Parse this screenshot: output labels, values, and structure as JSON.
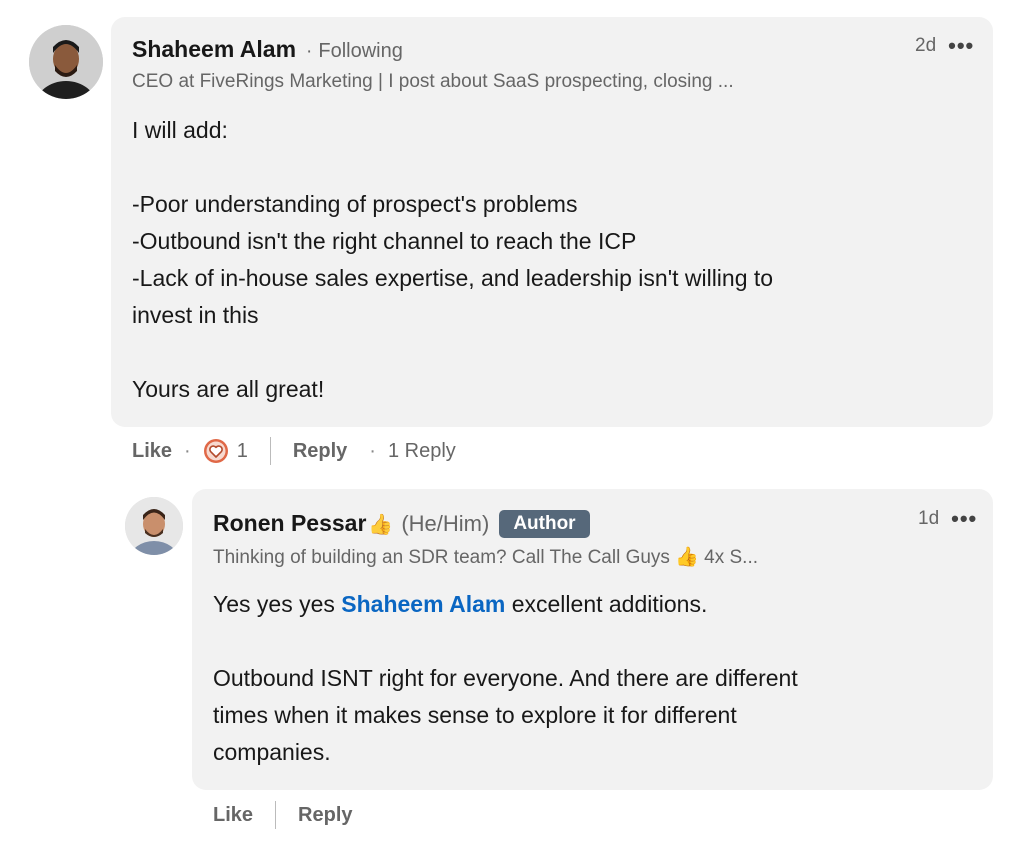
{
  "comment": {
    "author": "Shaheem Alam",
    "following": "Following",
    "headline": "CEO at FiveRings Marketing | I post about SaaS prospecting, closing ...",
    "time": "2d",
    "more_icon": "more-horizontal-icon",
    "body": {
      "line1": "I will add:",
      "line2": "-Poor understanding of prospect's problems",
      "line3": "-Outbound isn't the right channel to reach the ICP",
      "line4": "-Lack of in-house sales expertise, and leadership isn't willing to",
      "line5": "invest in this",
      "line6": "Yours are all great!"
    },
    "actions": {
      "like": "Like",
      "reaction_icon": "love-reaction-icon",
      "reaction_count": "1",
      "reply": "Reply",
      "reply_count": "1 Reply"
    }
  },
  "reply": {
    "author": "Ronen Pessar",
    "author_emoji": "👍",
    "pronouns": "(He/Him)",
    "badge": "Author",
    "headline": "Thinking of building an SDR team? Call The Call Guys 👍 4x S...",
    "time": "1d",
    "body": {
      "pre_mention": "Yes yes yes ",
      "mention": "Shaheem Alam",
      "post_mention": " excellent additions.",
      "line2": "Outbound ISNT right for everyone. And there are different",
      "line3": "times when it makes sense to explore it for different",
      "line4": "companies."
    },
    "actions": {
      "like": "Like",
      "reply": "Reply"
    }
  },
  "colors": {
    "bubble": "#f2f2f2",
    "mention": "#0a66c2",
    "badge": "#56687a",
    "heart": "#e06847"
  }
}
